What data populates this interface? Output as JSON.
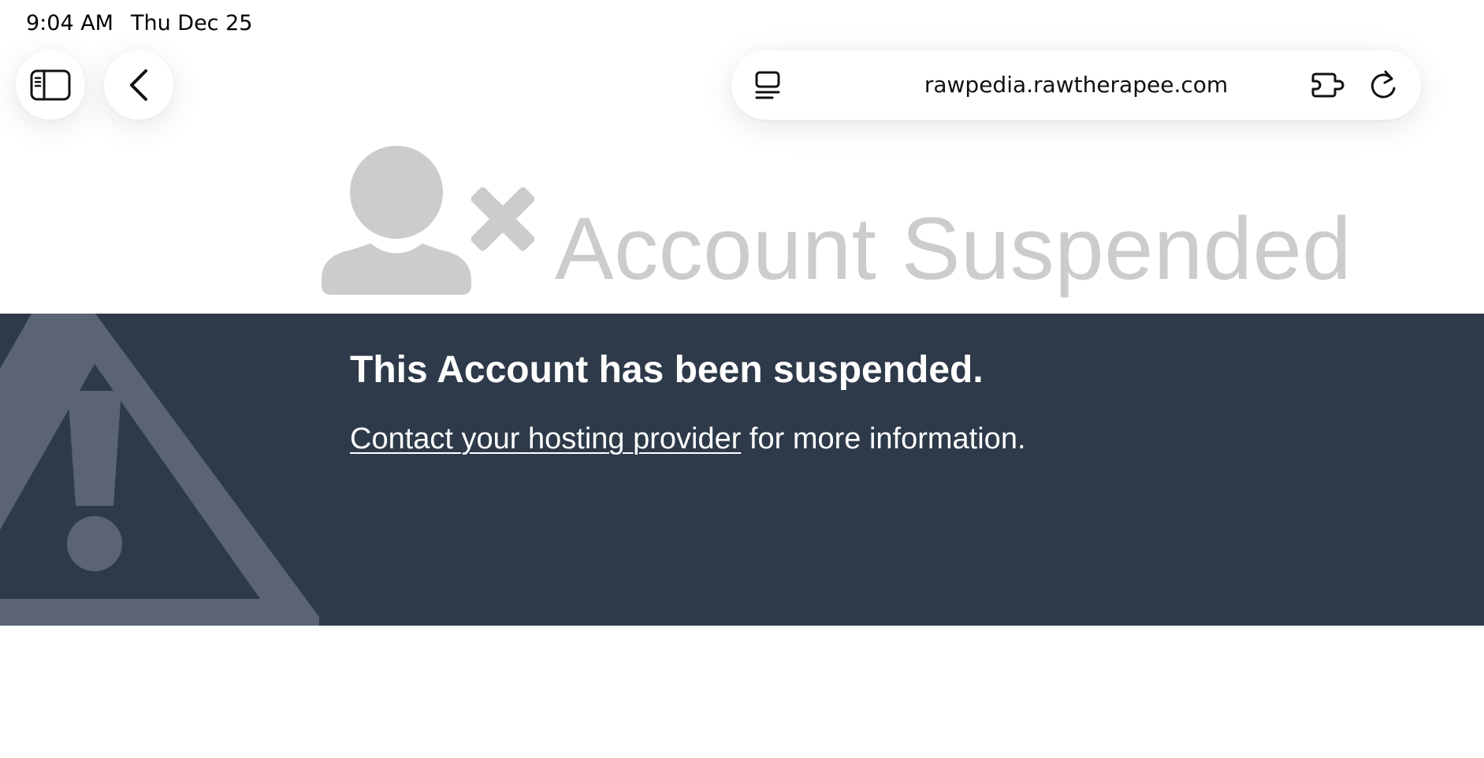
{
  "status_bar": {
    "time": "9:04 AM",
    "date": "Thu Dec 25"
  },
  "toolbar": {
    "sidebar_icon": "sidebar-icon",
    "back_icon": "chevron-left-icon",
    "tabs_icon": "tab-overview-icon",
    "url": "rawpedia.rawtherapee.com",
    "extension_icon": "extension-icon",
    "reload_icon": "reload-icon"
  },
  "page": {
    "hero_icon": "user-x-icon",
    "title": "Account Suspended",
    "heading": "This Account has been suspended.",
    "link_text": "Contact your hosting provider",
    "trailing_text": " for more information.",
    "warning_icon": "warning-triangle-icon"
  },
  "colors": {
    "band_background": "#2e3a4a",
    "title_gray": "#cccccc",
    "warning_gray": "#5a6472"
  }
}
